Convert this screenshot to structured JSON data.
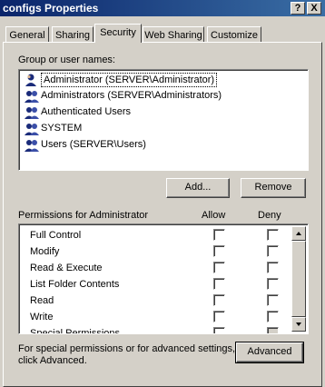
{
  "window": {
    "title": "configs Properties",
    "help_label": "?",
    "close_label": "X"
  },
  "tabs": [
    {
      "label": "General"
    },
    {
      "label": "Sharing"
    },
    {
      "label": "Security"
    },
    {
      "label": "Web Sharing"
    },
    {
      "label": "Customize"
    }
  ],
  "active_tab": "Security",
  "users": {
    "label": "Group or user names:",
    "items": [
      "Administrator (SERVER\\Administrator)",
      "Administrators (SERVER\\Administrators)",
      "Authenticated Users",
      "SYSTEM",
      "Users (SERVER\\Users)"
    ],
    "selected_index": 0
  },
  "buttons": {
    "add": "Add...",
    "remove": "Remove",
    "advanced": "Advanced"
  },
  "permissions": {
    "header": "Permissions for Administrator",
    "allow_header": "Allow",
    "deny_header": "Deny",
    "items": [
      "Full Control",
      "Modify",
      "Read & Execute",
      "List Folder Contents",
      "Read",
      "Write",
      "Special Permissions"
    ]
  },
  "advanced_text": {
    "line1": "For special permissions or for advanced settings,",
    "line2": "click Advanced."
  }
}
